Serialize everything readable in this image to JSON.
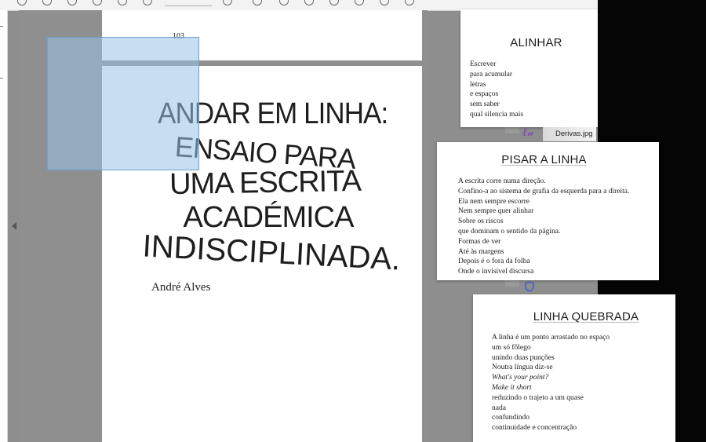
{
  "viewer": {
    "page_number": "103",
    "title_lines": [
      "ANDAR EM LINHA:",
      "ENSAIO PARA",
      "UMA ESCRITA",
      "ACADÉMICA",
      "INDISCIPLINADA."
    ],
    "author": "André Alves"
  },
  "notes": [
    {
      "title": "ALINHAR",
      "lines": [
        "Escrever",
        "para acumular",
        "letras",
        "e espaços",
        "sem saber",
        "qual silencia mais"
      ]
    },
    {
      "title": "PISAR A LINHA",
      "lines": [
        "A escrita corre numa direção.",
        "Confino-a ao sistema de grafia da esquerda para a direita.",
        "Ela nem sempre escorre",
        "Nem sempre quer alinhar",
        "Sobre os riscos",
        "que dominam o sentido da página.",
        "Formas de ver",
        "Até às margens",
        "Depois é o fora da folha",
        "Onde o invisível discursa"
      ]
    },
    {
      "title": "LINHA QUEBRADA",
      "lines": [
        "A linha é um ponto arrastado no espaço",
        "um só fôlego",
        "unindo duas punções",
        "Noutra língua diz-se",
        "What's your point?",
        "Make it short",
        "reduzindo o trajeto a um quase",
        "nada",
        "confundindo",
        "continuidade e concentração"
      ]
    }
  ],
  "desktop_file": {
    "label": "Derivas.jpg",
    "icon": "image-file-icon"
  },
  "colors": {
    "selection": "#96c3e6",
    "viewer_background": "#8f8f8f",
    "file_thumb_accent": "#7a3fc4"
  }
}
